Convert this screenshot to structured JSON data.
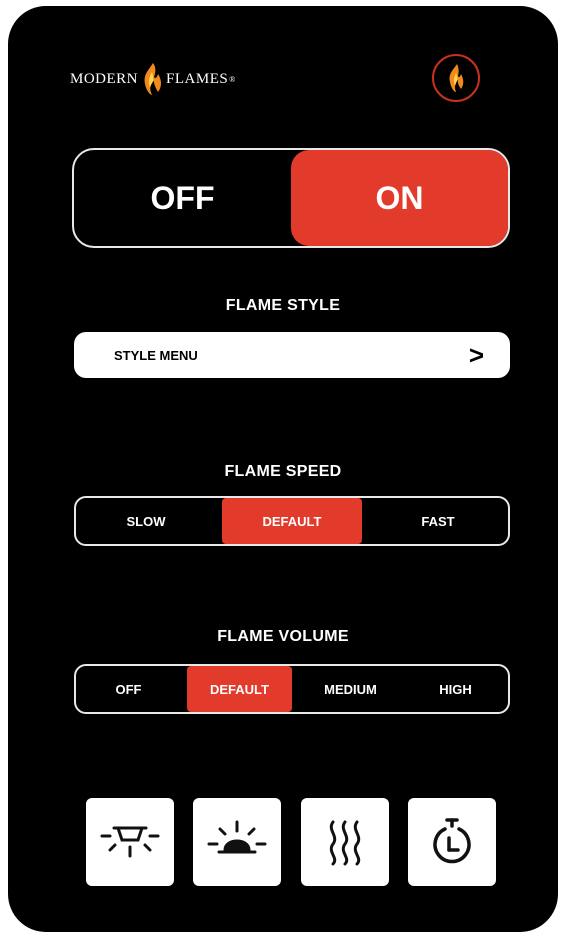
{
  "brand": {
    "name_left": "MODERN",
    "name_right": "FLAMES",
    "registered_mark": "®",
    "logo_icon": "flame-logo-icon",
    "badge_icon": "flame-badge-icon"
  },
  "power": {
    "off_label": "OFF",
    "on_label": "ON",
    "selected": "ON"
  },
  "flame_style": {
    "title": "FLAME STYLE",
    "menu_label": "STYLE MENU",
    "chevron": ">"
  },
  "flame_speed": {
    "title": "FLAME SPEED",
    "options": [
      "SLOW",
      "DEFAULT",
      "FAST"
    ],
    "selected": "DEFAULT"
  },
  "flame_volume": {
    "title": "FLAME VOLUME",
    "options": [
      "OFF",
      "DEFAULT",
      "MEDIUM",
      "HIGH"
    ],
    "selected": "DEFAULT"
  },
  "bottom_controls": [
    {
      "icon": "downlight-icon"
    },
    {
      "icon": "ember-bed-light-icon"
    },
    {
      "icon": "heater-icon"
    },
    {
      "icon": "timer-icon"
    }
  ],
  "colors": {
    "accent": "#e23a2b",
    "background": "#000000",
    "text": "#ffffff",
    "flame_orange": "#f08a1c"
  }
}
